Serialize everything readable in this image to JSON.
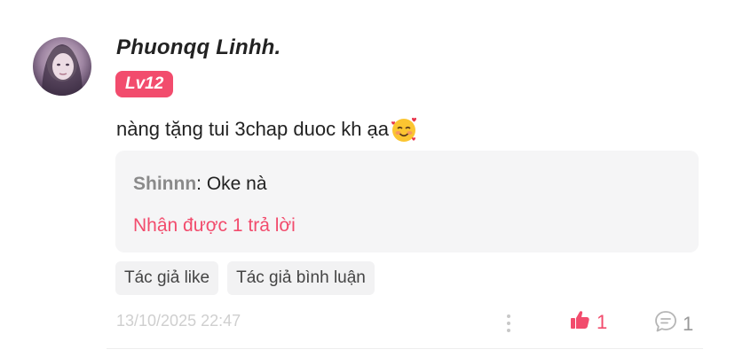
{
  "comment": {
    "username": "Phuonqq Linhh.",
    "level_badge": "Lv12",
    "text": "nàng tặng tui 3chap duoc kh ạa",
    "emoji": "smiling-face-with-hearts",
    "reply_preview": {
      "author": "Shinnn",
      "separator": ": ",
      "text": "Oke nà"
    },
    "reply_count_text": "Nhận được 1 trả lời",
    "tags": [
      "Tác giả like",
      "Tác giả bình luận"
    ],
    "timestamp": "13/10/2025 22:47",
    "like_count": "1",
    "reply_count": "1"
  },
  "colors": {
    "accent": "#f24c6d",
    "reply_box": "#f5f5f6",
    "tag_bg": "#f2f2f3",
    "muted": "#cfcfcf"
  },
  "icons": {
    "more": "more-vertical-icon",
    "like": "thumbs-up-icon",
    "reply": "comment-bubble-icon"
  }
}
